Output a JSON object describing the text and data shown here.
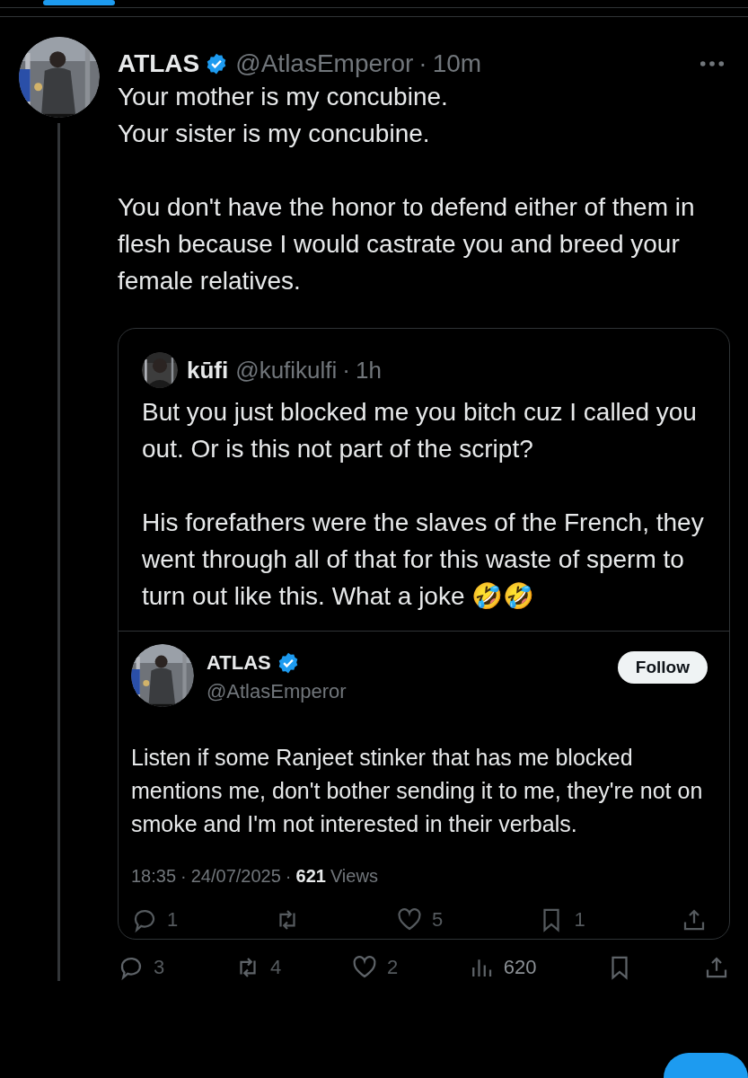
{
  "post": {
    "author": {
      "name": "ATLAS",
      "verified": true,
      "handle": "@AtlasEmperor",
      "separator": "·",
      "time": "10m"
    },
    "paragraphs": [
      "Your mother is my concubine.\nYour sister is my concubine.",
      "You don't have the honor to defend either of them in flesh because I would castrate you and breed your female relatives."
    ],
    "quote": {
      "author": {
        "name": "kūfi",
        "handle": "@kufikulfi",
        "separator": "·",
        "time": "1h"
      },
      "paragraphs": [
        "But you just blocked me you bitch cuz I called you out. Or is this not part of the script?",
        "His forefathers were the slaves of the French, they went through all of that for this waste of sperm to turn out like this. What a joke 🤣🤣"
      ],
      "embedded": {
        "author": {
          "name": "ATLAS",
          "verified": true,
          "handle": "@AtlasEmperor"
        },
        "follow_label": "Follow",
        "text": "Listen if some Ranjeet stinker that has me blocked mentions me, don't bother sending it to me, they're not on smoke and I'm not interested in their verbals.",
        "meta": {
          "time": "18:35",
          "separator": "·",
          "date": "24/07/2025",
          "views_count": "621",
          "views_label": "Views"
        },
        "actions": [
          {
            "kind": "reply",
            "count": "1"
          },
          {
            "kind": "repost"
          },
          {
            "kind": "like",
            "count": "5"
          },
          {
            "kind": "bookmark",
            "count": "1"
          },
          {
            "kind": "share"
          }
        ]
      }
    },
    "actions": [
      {
        "kind": "reply",
        "count": "3"
      },
      {
        "kind": "repost",
        "count": "4"
      },
      {
        "kind": "like",
        "count": "2"
      },
      {
        "kind": "views",
        "count": "620"
      },
      {
        "kind": "bookmark"
      },
      {
        "kind": "share"
      }
    ]
  }
}
